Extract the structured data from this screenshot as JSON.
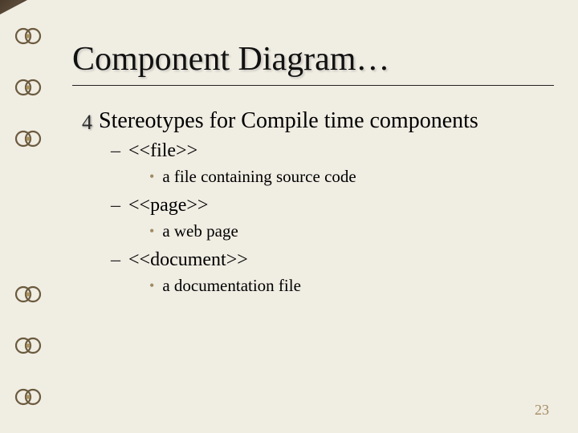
{
  "title": "Component Diagram…",
  "lvl1_text": "Stereotypes for Compile time components",
  "items": [
    {
      "name": "<<file>>",
      "desc": "a file containing source code"
    },
    {
      "name": "<<page>>",
      "desc": "a web page"
    },
    {
      "name": "<<document>>",
      "desc": "a documentation file"
    }
  ],
  "page_number": "23"
}
